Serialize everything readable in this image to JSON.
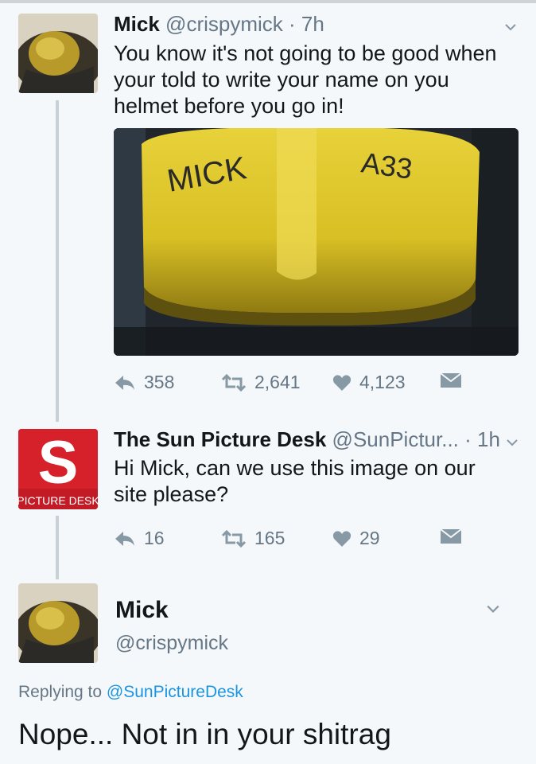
{
  "tweet1": {
    "name": "Mick",
    "handle": "@crispymick",
    "time": "7h",
    "text_lines": [
      "You know it's not going to be good when",
      "your told to write your name on you",
      "helmet before you go in!"
    ],
    "photo": {
      "helmet_label_left": "MICK",
      "helmet_label_right": "A33"
    },
    "replies": "358",
    "retweets": "2,641",
    "likes": "4,123"
  },
  "tweet2": {
    "name": "The Sun Picture Desk",
    "handle": "@SunPictur...",
    "time": "1h",
    "text_lines": [
      "Hi Mick, can we use this image on our",
      "site please?"
    ],
    "avatar_text": "PICTURE DESK",
    "avatar_letter": "S",
    "replies": "16",
    "retweets": "165",
    "likes": "29"
  },
  "tweet3": {
    "name": "Mick",
    "handle": "@crispymick",
    "replying_prefix": "Replying to",
    "replying_to": "@SunPictureDesk",
    "text": "Nope... Not in in your shitrag"
  },
  "colors": {
    "link": "#1b95e0",
    "meta": "#657786",
    "sun_red": "#d6202a"
  }
}
